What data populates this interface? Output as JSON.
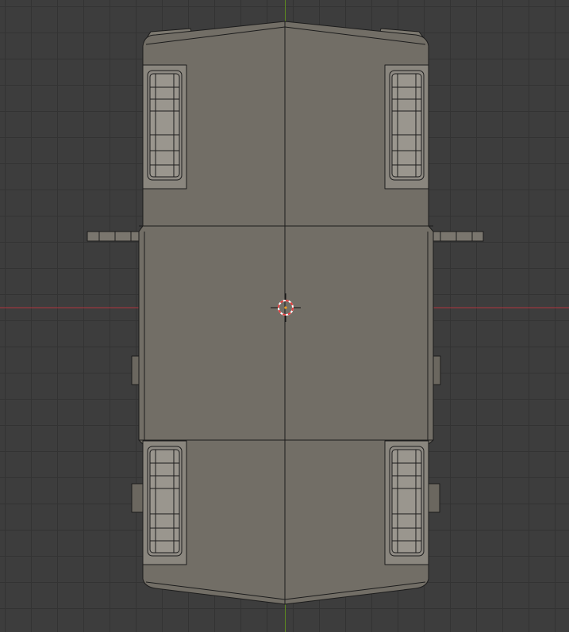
{
  "viewport": {
    "view": "top-orthographic",
    "grid": true,
    "colors": {
      "background": "#3d3d3d",
      "grid_line": "#333333",
      "x_axis": "#b0353f",
      "y_axis": "#5e8a20",
      "mesh_face": "#726e66",
      "mesh_edge": "#1c1c1c",
      "wheel_face": "#8e8a83",
      "cursor_ring_red": "#e53d3d",
      "cursor_ring_white": "#ffffff"
    }
  },
  "model": {
    "object": "vehicle-body",
    "wheels": 4,
    "mirrors": 2,
    "selected": false
  },
  "cursor": {
    "icon": "3d-cursor-icon"
  }
}
